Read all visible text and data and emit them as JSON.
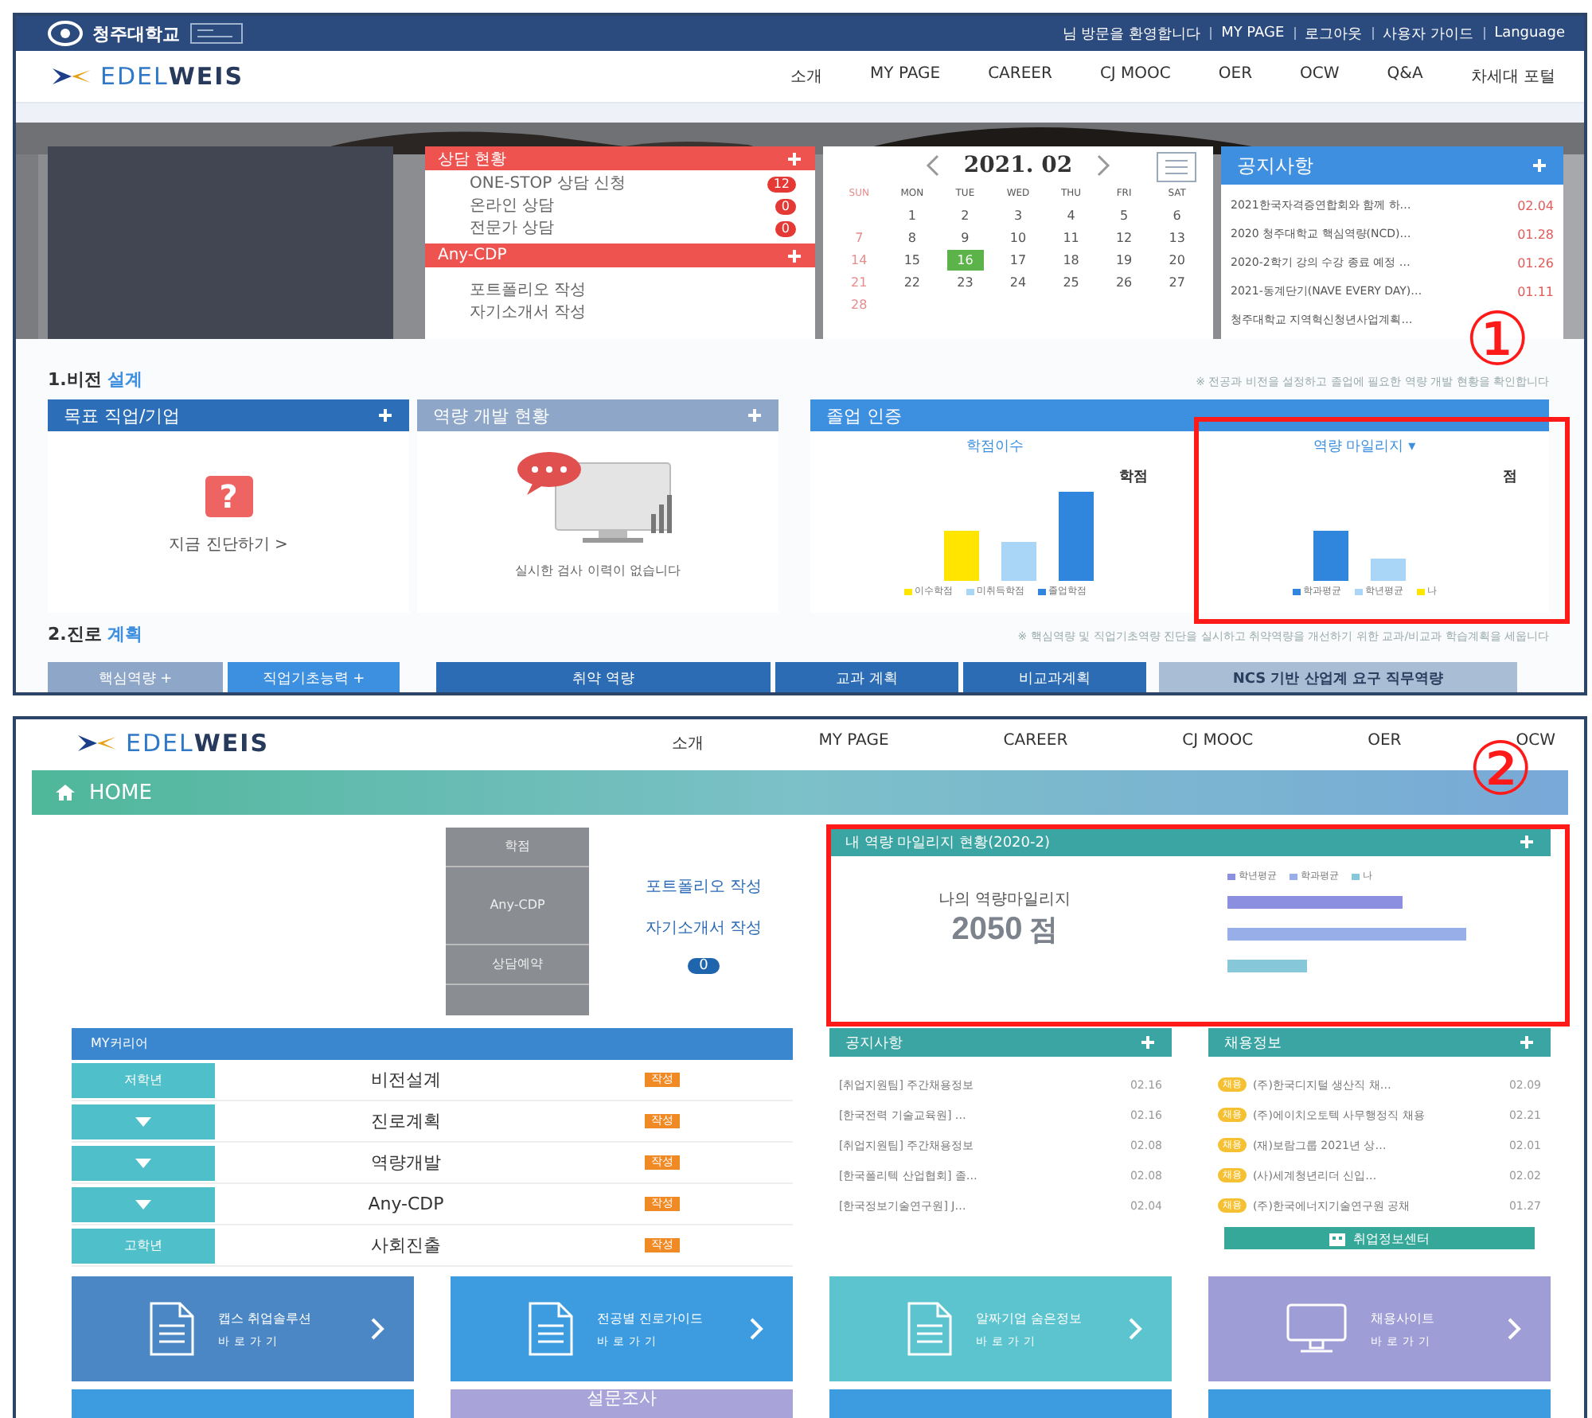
{
  "panel1": {
    "topbar": {
      "university": "청주대학교",
      "links": [
        "님 방문을 환영합니다",
        "MY PAGE",
        "로그아웃",
        "사용자 가이드",
        "Language"
      ]
    },
    "logo": "EDEL**WEIS**",
    "nav": [
      "소개",
      "MY PAGE",
      "CAREER",
      "CJ MOOC",
      "OER",
      "OCW",
      "Q&A",
      "차세대 포털"
    ],
    "counsel": {
      "title": "상담 현황",
      "items": [
        {
          "label": "ONE-STOP 상담 신청",
          "count": "12"
        },
        {
          "label": "온라인 상담",
          "count": "0"
        },
        {
          "label": "전문가 상담",
          "count": "0"
        }
      ]
    },
    "anycdp": {
      "title": "Any-CDP",
      "items": [
        "포트폴리오 작성",
        "자기소개서 작성"
      ]
    },
    "calendar": {
      "month": "2021. 02",
      "weekdays": [
        "SUN",
        "MON",
        "TUE",
        "WED",
        "THU",
        "FRI",
        "SAT"
      ],
      "weeks": [
        [
          {
            "day": "1",
            "selected": false
          },
          {
            "day": "2",
            "selected": false
          },
          {
            "day": "3",
            "selected": false
          },
          {
            "day": "4",
            "selected": false
          },
          {
            "day": "5",
            "selected": false
          },
          {
            "day": "6",
            "selected": false
          }
        ],
        [
          {
            "day": "7",
            "selected": false
          },
          {
            "day": "8",
            "selected": false
          },
          {
            "day": "9",
            "selected": false
          },
          {
            "day": "10",
            "selected": false
          },
          {
            "day": "11",
            "selected": false
          },
          {
            "day": "12",
            "selected": false
          },
          {
            "day": "13",
            "selected": false
          }
        ],
        [
          {
            "day": "14",
            "selected": false
          },
          {
            "day": "15",
            "selected": false
          },
          {
            "day": "16",
            "selected": true
          },
          {
            "day": "17",
            "selected": false
          },
          {
            "day": "18",
            "selected": false
          },
          {
            "day": "19",
            "selected": false
          },
          {
            "day": "20",
            "selected": false
          }
        ],
        [
          {
            "day": "21",
            "selected": false
          },
          {
            "day": "22",
            "selected": false
          },
          {
            "day": "23",
            "selected": false
          },
          {
            "day": "24",
            "selected": false
          },
          {
            "day": "25",
            "selected": false
          },
          {
            "day": "26",
            "selected": false
          },
          {
            "day": "27",
            "selected": false
          }
        ],
        [
          {
            "day": "28",
            "selected": false
          }
        ]
      ]
    },
    "notices": {
      "title": "공지사항",
      "items": [
        {
          "title": "2021한국자격증연합회와 함께 하…",
          "date": "02.04"
        },
        {
          "title": "2020 청주대학교 핵심역량(NCD)…",
          "date": "01.28"
        },
        {
          "title": "2020-2학기 강의 수강 종료 예정 …",
          "date": "01.26"
        },
        {
          "title": "2021-동계단기(NAVE EVERY DAY)…",
          "date": "01.11"
        },
        {
          "title": "청주대학교 지역혁신청년사업계획…"
        }
      ]
    },
    "vision": {
      "title": "1.비전 **설계**",
      "note": "※ 전공과 비전을 설정하고 졸업에 필요한 역량 개발 현황을 확인합니다",
      "goal": {
        "title": "목표 직업/기업",
        "icon": "?",
        "link": "지금 진단하기 >"
      },
      "competency": {
        "title": "역량 개발 현황",
        "message": "실시한 검사 이력이 없습니다"
      },
      "graduation": {
        "title": "졸업 인증",
        "charts": [
          {
            "title": "학점이수",
            "unit": "학점",
            "legend": [
              {
                "label": "이수학점",
                "color": "#ffe500"
              },
              {
                "label": "미취득학점",
                "color": "#a9d5f7"
              },
              {
                "label": "졸업학점",
                "color": "#2f86dc"
              }
            ]
          },
          {
            "title": "역량 마일리지 ▾",
            "unit": "점",
            "legend": [
              {
                "label": "학과평균",
                "color": "#2f86dc"
              },
              {
                "label": "학년평균",
                "color": "#a9d5f7"
              },
              {
                "label": "나",
                "color": "#ffe500"
              }
            ]
          }
        ]
      }
    },
    "career": {
      "title": "2.진로 **계획**",
      "note": "※ 핵심역량 및 직업기초역량 진단을 실시하고 취약역량을 개선하기 위한 교과/비교과 학습계획을 세웁니다",
      "tabs": [
        {
          "label": "핵심역량 +",
          "kind": "light"
        },
        {
          "label": "직업기초능력 +",
          "kind": "mid"
        },
        {
          "label": "취약 역량",
          "kind": "dark"
        },
        {
          "label": "교과 계획",
          "kind": "dark"
        },
        {
          "label": "비교과계획",
          "kind": "dark"
        },
        {
          "label": "NCS 기반 산업계 요구 직무역량",
          "kind": "grey"
        }
      ]
    },
    "marker": "①"
  },
  "panel2": {
    "logo": "EDEL**WEIS**",
    "nav": [
      "소개",
      "MY PAGE",
      "CAREER",
      "CJ MOOC",
      "OER",
      "OCW"
    ],
    "home": "HOME",
    "status_table": [
      "학점",
      "Any-CDP",
      "상담예약"
    ],
    "status_links": [
      "포트폴리오 작성",
      "자기소개서 작성"
    ],
    "status_count": "0",
    "mileage": {
      "title": "내 역량 마일리지 현황(2020-2)",
      "label": "나의 역량마일리지",
      "score": "2050",
      "unit": "점",
      "legend": [
        {
          "label": "학년평균",
          "color": "#8c8ee0"
        },
        {
          "label": "학과평균",
          "color": "#98aee8"
        },
        {
          "label": "나",
          "color": "#86c7d9"
        }
      ]
    },
    "my_career": {
      "title": "MY커리어",
      "rows": [
        {
          "kind": "stage",
          "stage": "저학년",
          "label": "비전설계",
          "badge": "작성"
        },
        {
          "kind": "toggle",
          "label": "진로계획",
          "badge": "작성"
        },
        {
          "kind": "toggle",
          "label": "역량개발",
          "badge": "작성"
        },
        {
          "kind": "toggle",
          "label": "Any-CDP",
          "badge": "작성"
        },
        {
          "kind": "stage",
          "stage": "고학년",
          "label": "사회진출",
          "badge": "작성"
        }
      ]
    },
    "notices": {
      "title": "공지사항",
      "items": [
        {
          "title": "[취업지원팀] 주간채용정보",
          "date": "02.16"
        },
        {
          "title": "[한국전력 기술교육원] …",
          "date": "02.16"
        },
        {
          "title": "[취업지원팀] 주간채용정보",
          "date": "02.08"
        },
        {
          "title": "[한국폴리텍 산업협회] 졸…",
          "date": "02.08"
        },
        {
          "title": "[한국정보기술연구원] J…",
          "date": "02.04"
        }
      ]
    },
    "jobs": {
      "title": "채용정보",
      "items": [
        {
          "tag": "채용",
          "title": "(주)한국디지털 생산직 채…",
          "date": "02.09"
        },
        {
          "tag": "채용",
          "title": "(주)에이치오토텍 사무행정직 채용",
          "date": "02.21"
        },
        {
          "tag": "채용",
          "title": "(재)보람그룹 2021년 상…",
          "date": "02.01"
        },
        {
          "tag": "채용",
          "title": "(사)세계청년리더 신입…",
          "date": "02.02"
        },
        {
          "tag": "채용",
          "title": "(주)한국에너지기술연구원 공채",
          "date": "01.27"
        }
      ],
      "button": "취업정보센터"
    },
    "tiles": [
      {
        "title": "캡스 취업솔루션",
        "sub": "바로가기",
        "kind": "document",
        "color": "#4a87c4"
      },
      {
        "title": "전공별 진로가이드",
        "sub": "바로가기",
        "kind": "document",
        "color": "#3d9ce0"
      },
      {
        "title": "알짜기업 숨은정보",
        "sub": "바로가기",
        "kind": "document",
        "color": "#5cc4cf"
      },
      {
        "title": "채용사이트",
        "sub": "바로가기",
        "kind": "monitor",
        "color": "#9f9dd6"
      }
    ],
    "tiles_next": [
      {
        "color": "#3d9ce0"
      },
      {
        "title": "설문조사",
        "color": "#a8a3d8"
      },
      {
        "color": "#3d9ce0"
      },
      {
        "color": "#3d9ce0"
      }
    ],
    "marker": "②"
  }
}
